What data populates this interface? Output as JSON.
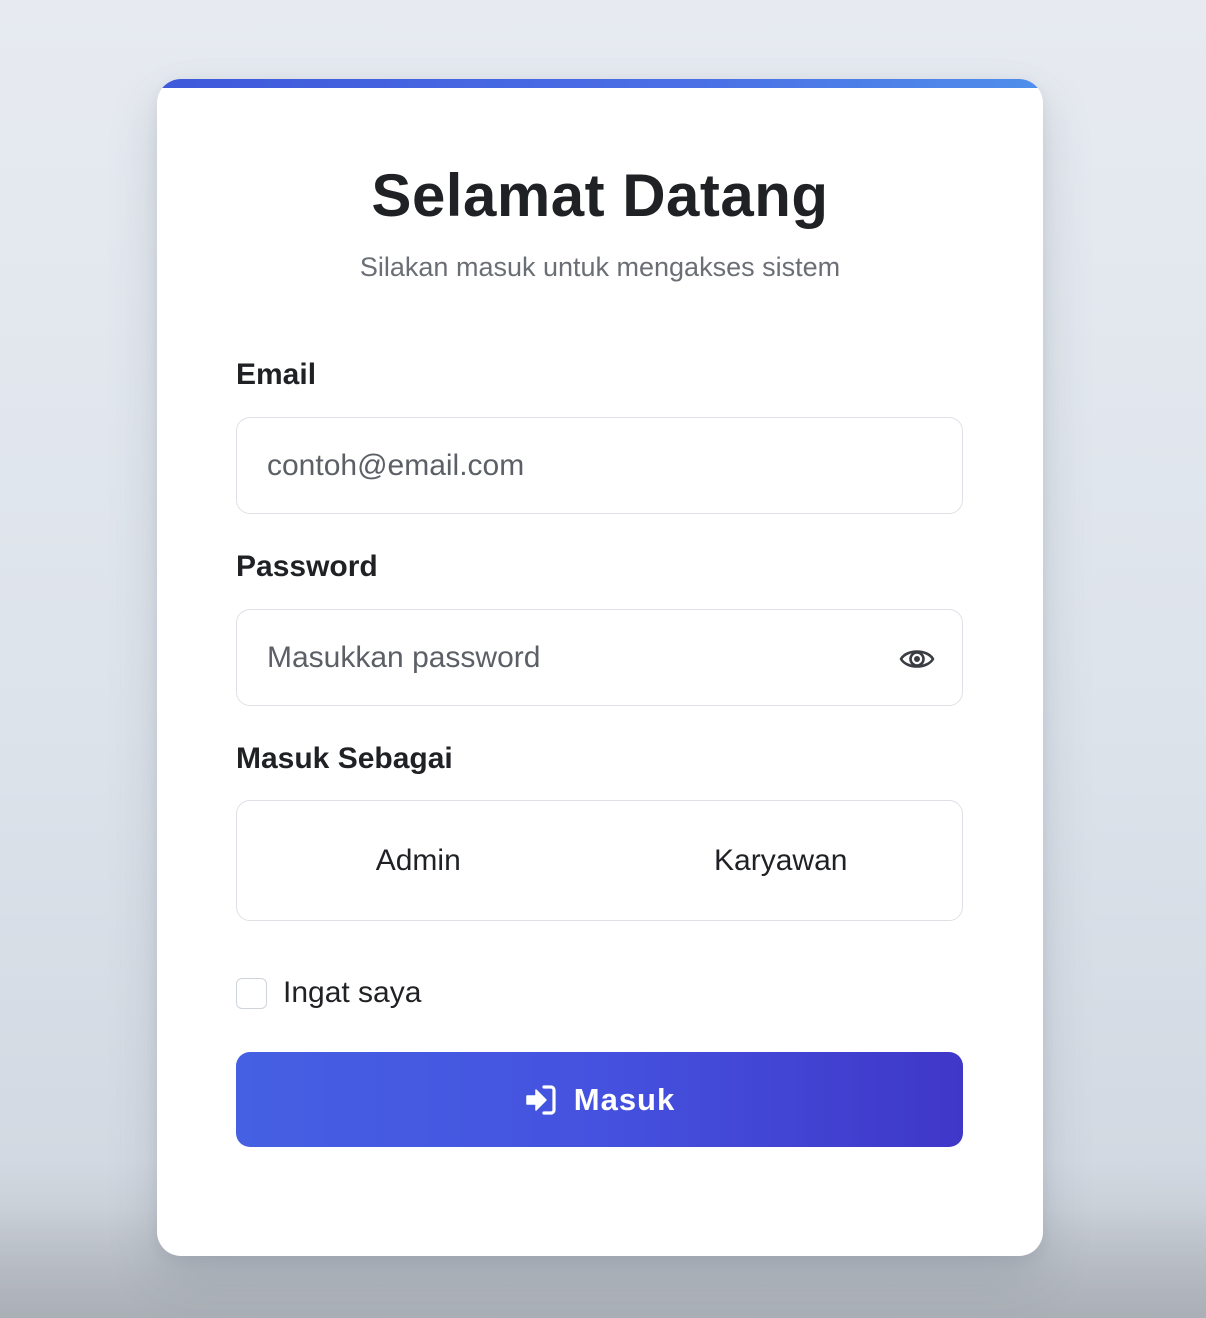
{
  "header": {
    "title": "Selamat Datang",
    "subtitle": "Silakan masuk untuk mengakses sistem"
  },
  "form": {
    "email": {
      "label": "Email",
      "placeholder": "contoh@email.com",
      "value": ""
    },
    "password": {
      "label": "Password",
      "placeholder": "Masukkan password",
      "value": "",
      "toggle_icon": "eye-icon"
    },
    "role": {
      "label": "Masuk Sebagai",
      "options": [
        "Admin",
        "Karyawan"
      ]
    },
    "remember": {
      "label": "Ingat saya",
      "checked": false
    },
    "submit": {
      "label": "Masuk",
      "icon": "sign-in-icon"
    }
  },
  "colors": {
    "accent": "#4552df",
    "accent_dark": "#3f37c8",
    "text": "#1f2124",
    "muted": "#6b6f75"
  }
}
